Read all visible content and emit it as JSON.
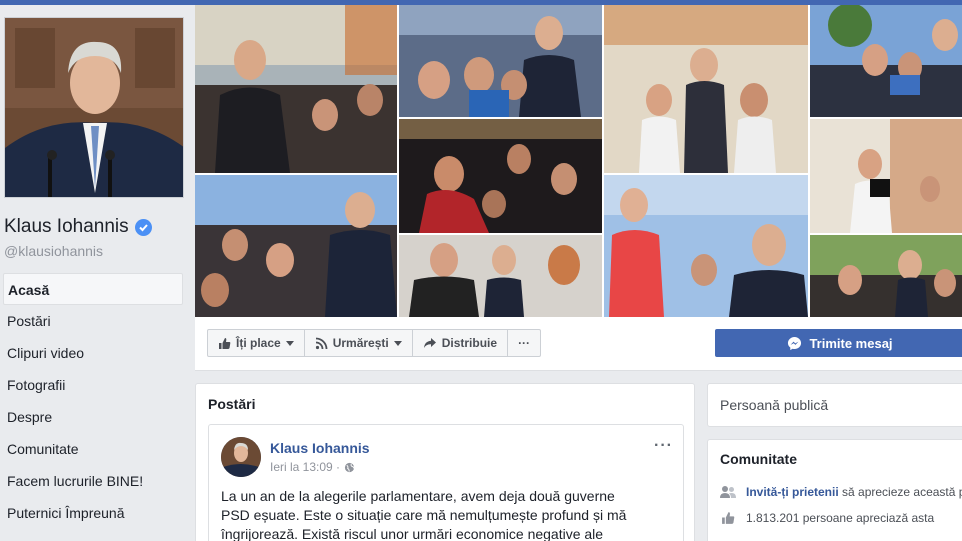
{
  "page": {
    "name": "Klaus Iohannis",
    "handle": "@klausiohannis"
  },
  "nav": {
    "items": [
      {
        "label": "Acasă"
      },
      {
        "label": "Postări"
      },
      {
        "label": "Clipuri video"
      },
      {
        "label": "Fotografii"
      },
      {
        "label": "Despre"
      },
      {
        "label": "Comunitate"
      },
      {
        "label": "Facem lucrurile BINE!"
      },
      {
        "label": "Puternici Împreună"
      }
    ]
  },
  "actions": {
    "like_label": "Îți place",
    "follow_label": "Urmărești",
    "share_label": "Distribuie",
    "more_label": "···",
    "message_label": "Trimite mesaj"
  },
  "posts": {
    "title": "Postări",
    "post": {
      "author": "Klaus Iohannis",
      "time": "Ieri la 13:09 ·",
      "more": "···",
      "text": "La un an de la alegerile parlamentare, avem deja două guverne PSD eșuate. Este o situație care mă nemulțumește profund și mă îngrijorează. Există riscul unor urmări economice negative ale acestei"
    }
  },
  "category": {
    "label": "Persoană publică"
  },
  "community": {
    "title": "Comunitate",
    "invite_link": "Invită-ți prietenii",
    "invite_rest": "să aprecieze această p",
    "likes_text": "1.813.201 persoane apreciază asta"
  },
  "colors": {
    "brand": "#4267b2",
    "link": "#365899",
    "background": "#e9ebee"
  }
}
